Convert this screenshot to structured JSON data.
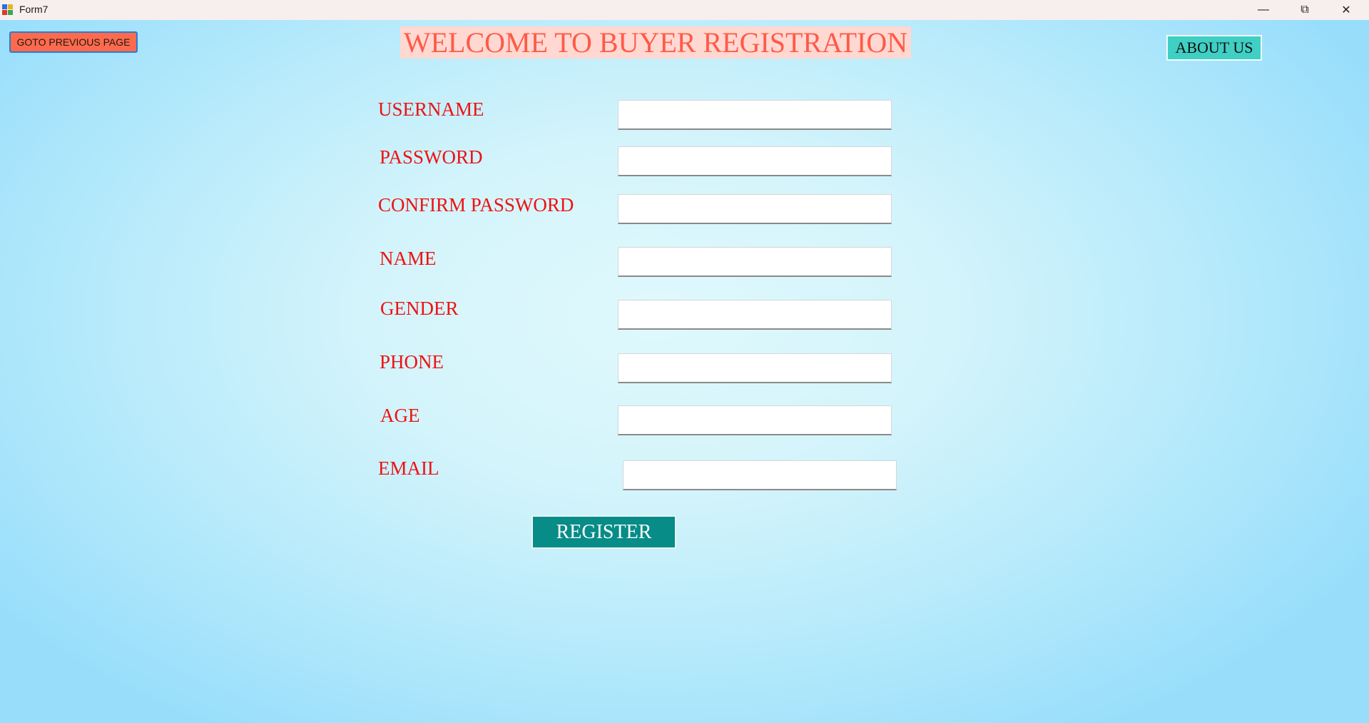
{
  "window": {
    "title": "Form7",
    "minimize_icon": "minimize-icon",
    "restore_icon": "restore-icon",
    "close_icon": "close-icon",
    "minimize_glyph": "—",
    "restore_glyph": "⧉",
    "close_glyph": "✕"
  },
  "header": {
    "prev_button": "GOTO PREVIOUS PAGE",
    "welcome": "WELCOME TO BUYER REGISTRATION",
    "about_button": "ABOUT US"
  },
  "form": {
    "fields": [
      {
        "label": "USERNAME",
        "value": ""
      },
      {
        "label": "PASSWORD",
        "value": ""
      },
      {
        "label": "CONFIRM PASSWORD",
        "value": ""
      },
      {
        "label": "NAME",
        "value": ""
      },
      {
        "label": "GENDER",
        "value": ""
      },
      {
        "label": "PHONE",
        "value": ""
      },
      {
        "label": "AGE",
        "value": ""
      },
      {
        "label": "EMAIL",
        "value": ""
      }
    ],
    "register_button": "REGISTER"
  },
  "colors": {
    "label": "#ee1212",
    "welcome_text": "#ff5a47",
    "welcome_bg": "#ffd8d2",
    "prev_button_bg": "#ff6a4d",
    "about_button_bg": "#40cfc4",
    "register_button_bg": "#078c87",
    "background_center": "#dff9fc",
    "background_edge": "#98defb"
  }
}
